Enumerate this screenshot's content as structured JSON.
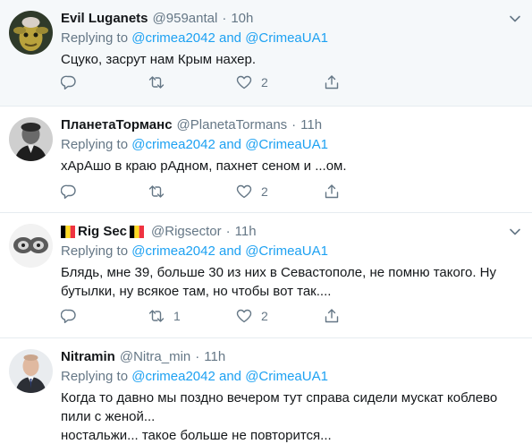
{
  "colors": {
    "accent": "#1da1f2",
    "muted": "#657786",
    "text": "#14171a",
    "divider": "#e6ecf0",
    "highlight_bg": "#f5f8fa"
  },
  "tweets": [
    {
      "name": "Evil Luganets",
      "handle": "@959antal",
      "dot": "·",
      "time": "10h",
      "replying_prefix": "Replying to",
      "mention1": "@crimea2042",
      "and": "and",
      "mention2": "@CrimeaUA1",
      "lines": [
        "Сцуко, засрут нам Крым нахер."
      ],
      "reply_count": "",
      "retweet_count": "",
      "like_count": "2",
      "avatar_icon": "alien-avatar"
    },
    {
      "name": "ПланетаТорманс",
      "handle": "@PlanetaTormans",
      "dot": "·",
      "time": "11h",
      "replying_prefix": "Replying to",
      "mention1": "@crimea2042",
      "and": "and",
      "mention2": "@CrimeaUA1",
      "lines": [
        "хАрАшо в краю рАдном, пахнет сеном и ...ом."
      ],
      "reply_count": "",
      "retweet_count": "",
      "like_count": "2",
      "avatar_icon": "bw-portrait-avatar"
    },
    {
      "name": "Rig Sec",
      "handle": "@Rigsector",
      "dot": "·",
      "time": "11h",
      "replying_prefix": "Replying to",
      "mention1": "@crimea2042",
      "and": "and",
      "mention2": "@CrimeaUA1",
      "lines": [
        "Блядь, мне 39, больше 30 из них в Севастополе, не помню такого. Ну",
        "бутылки, ну всякое там, но чтобы вот так...."
      ],
      "reply_count": "",
      "retweet_count": "1",
      "like_count": "2",
      "avatar_icon": "sheep-avatar",
      "flag_icon": "belgian-flag-icon"
    },
    {
      "name": "Nitramin",
      "handle": "@Nitra_min",
      "dot": "·",
      "time": "11h",
      "replying_prefix": "Replying to",
      "mention1": "@crimea2042",
      "and": "and",
      "mention2": "@CrimeaUA1",
      "lines": [
        "Когда то давно мы поздно вечером тут справа сидели мускат коблево",
        "пили с женой...",
        "ностальжи... такое больше не повторится..."
      ],
      "reply_count": "",
      "retweet_count": "",
      "like_count": "",
      "avatar_icon": "suited-man-avatar"
    }
  ]
}
